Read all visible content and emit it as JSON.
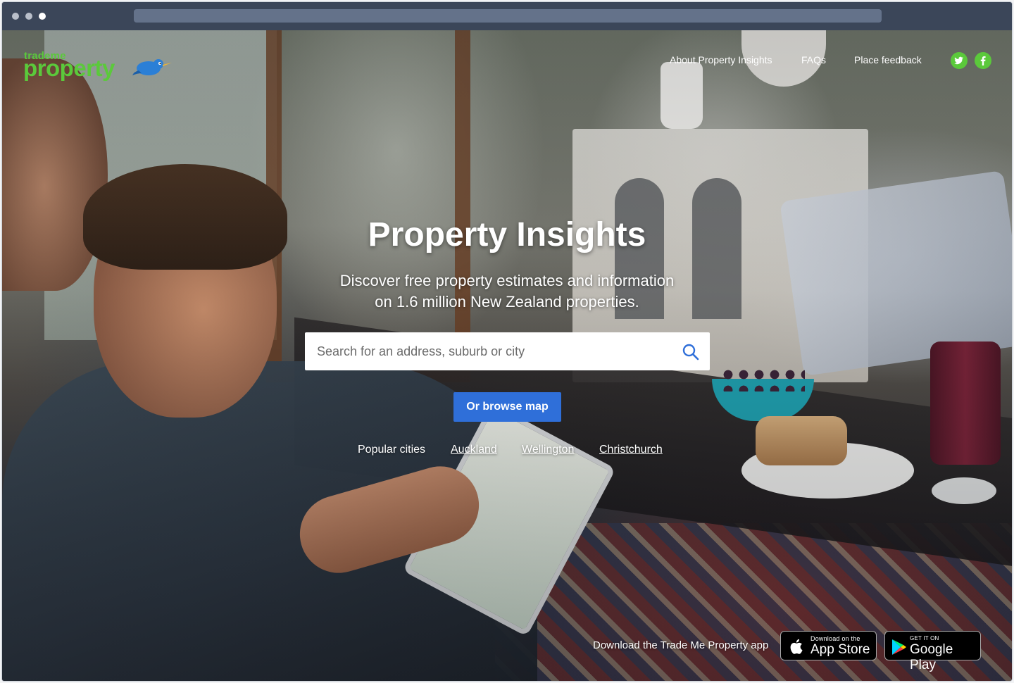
{
  "window": {
    "dots": [
      "close",
      "minimize",
      "maximize"
    ]
  },
  "brand": {
    "top": "trademe",
    "name": "property",
    "mascot_icon": "kiwi-bird-icon",
    "color": "#5bc93b"
  },
  "nav": {
    "items": [
      {
        "label": "About Property Insights"
      },
      {
        "label": "FAQs"
      },
      {
        "label": "Place feedback"
      }
    ],
    "social": [
      {
        "icon": "twitter-icon"
      },
      {
        "icon": "facebook-icon"
      }
    ]
  },
  "hero": {
    "title": "Property Insights",
    "subtitle_line1": "Discover free property estimates and information",
    "subtitle_line2": "on 1.6 million New Zealand properties."
  },
  "search": {
    "value": "",
    "placeholder": "Search for an address, suburb or city",
    "icon": "search-icon"
  },
  "browse": {
    "label": "Or browse map",
    "color": "#2f6fd9"
  },
  "popular": {
    "label": "Popular cities",
    "cities": [
      "Auckland",
      "Wellington",
      "Christchurch"
    ]
  },
  "apps": {
    "label": "Download the Trade Me Property app",
    "apple": {
      "line1": "Download on the",
      "line2": "App Store",
      "icon": "apple-icon"
    },
    "google": {
      "line1": "GET IT ON",
      "line2": "Google Play",
      "icon": "google-play-icon"
    }
  }
}
